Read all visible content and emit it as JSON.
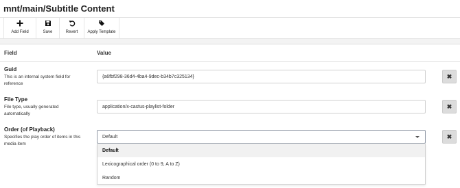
{
  "page": {
    "title": "mnt/main/Subtitle Content"
  },
  "toolbar": {
    "buttons": [
      {
        "label": "Add Field",
        "icon": "plus-icon"
      },
      {
        "label": "Save",
        "icon": "floppy-disk-icon"
      },
      {
        "label": "Revert",
        "icon": "undo-icon"
      },
      {
        "label": "Apply Template",
        "icon": "tags-icon"
      }
    ]
  },
  "table": {
    "headers": {
      "field": "Field",
      "value": "Value"
    },
    "rows": [
      {
        "name": "Guid",
        "description": "This is an internal system field for reference",
        "value": "{a6fbf298-36d4-4ba4-9dec-b34b7c325134}"
      },
      {
        "name": "File Type",
        "description": "File type, usually generated automatically",
        "value": "application/x-castus-playlist-folder"
      },
      {
        "name": "Order (of Playback)",
        "description": "Specifies the play order of items in this media item",
        "value": "Default"
      }
    ]
  },
  "dropdown": {
    "options": [
      "Default",
      "Lexicographical order (0 to 9, A to Z)",
      "Random"
    ],
    "selected": "Default"
  },
  "clear_button": {
    "label": "✖"
  }
}
